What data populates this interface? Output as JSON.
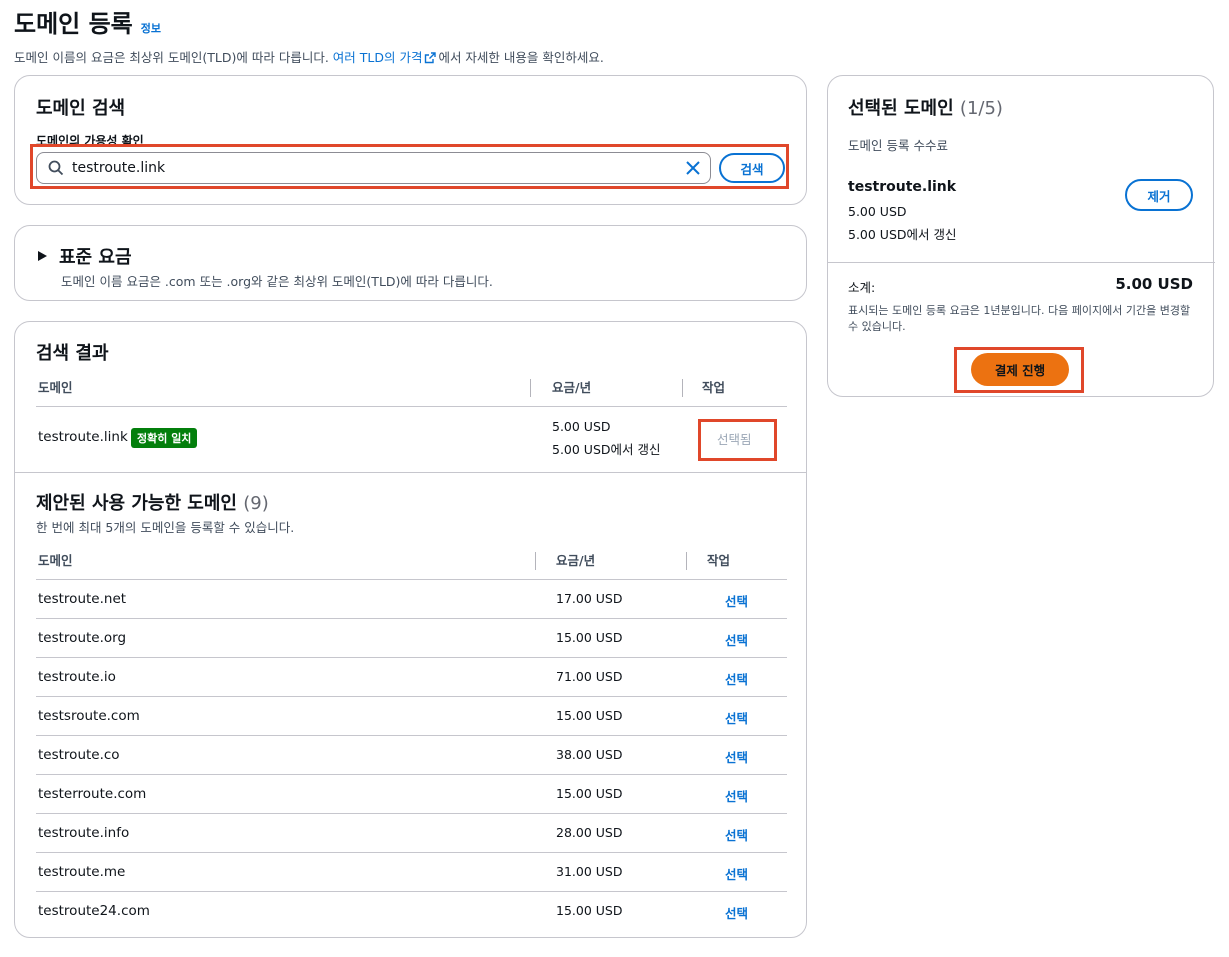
{
  "header": {
    "title": "도메인 등록",
    "info": "정보",
    "subtitle_pre": "도메인 이름의 요금은 최상위 도메인(TLD)에 따라 다릅니다.",
    "subtitle_link": "여러 TLD의 가격",
    "subtitle_post": "에서 자세한 내용을 확인하세요."
  },
  "search": {
    "title": "도메인 검색",
    "label": "도메인의 가용성 확인",
    "value": "testroute.link",
    "button": "검색"
  },
  "pricing": {
    "title": "표준 요금",
    "description": "도메인 이름 요금은 .com 또는 .org와 같은 최상위 도메인(TLD)에 따라 다릅니다."
  },
  "results": {
    "title": "검색 결과",
    "columns": [
      "도메인",
      "요금/년",
      "작업"
    ],
    "row": {
      "domain": "testroute.link",
      "badge": "정확히 일치",
      "price": "5.00 USD",
      "renewal": "5.00 USD에서 갱신",
      "action": "선택됨"
    }
  },
  "suggested": {
    "title": "제안된 사용 가능한 도메인",
    "count": "(9)",
    "description": "한 번에 최대 5개의 도메인을 등록할 수 있습니다.",
    "columns": [
      "도메인",
      "요금/년",
      "작업"
    ],
    "action_label": "선택",
    "rows": [
      {
        "domain": "testroute.net",
        "price": "17.00 USD"
      },
      {
        "domain": "testroute.org",
        "price": "15.00 USD"
      },
      {
        "domain": "testroute.io",
        "price": "71.00 USD"
      },
      {
        "domain": "testsroute.com",
        "price": "15.00 USD"
      },
      {
        "domain": "testroute.co",
        "price": "38.00 USD"
      },
      {
        "domain": "testerroute.com",
        "price": "15.00 USD"
      },
      {
        "domain": "testroute.info",
        "price": "28.00 USD"
      },
      {
        "domain": "testroute.me",
        "price": "31.00 USD"
      },
      {
        "domain": "testroute24.com",
        "price": "15.00 USD"
      }
    ]
  },
  "selected": {
    "title": "선택된 도메인",
    "count": "(1/5)",
    "fee_label": "도메인 등록 수수료",
    "domain": "testroute.link",
    "price": "5.00 USD",
    "renewal": "5.00 USD에서 갱신",
    "remove": "제거",
    "subtotal_label": "소계:",
    "subtotal_value": "5.00 USD",
    "note": "표시되는 도메인 등록 요금은 1년분입니다. 다음 페이지에서 기간을 변경할 수 있습니다.",
    "checkout": "결제 진행"
  },
  "colors": {
    "link": "#0972d3",
    "primary_button": "#ec7211",
    "exact_badge": "#037f0c",
    "highlight_outline": "#e0472a"
  }
}
